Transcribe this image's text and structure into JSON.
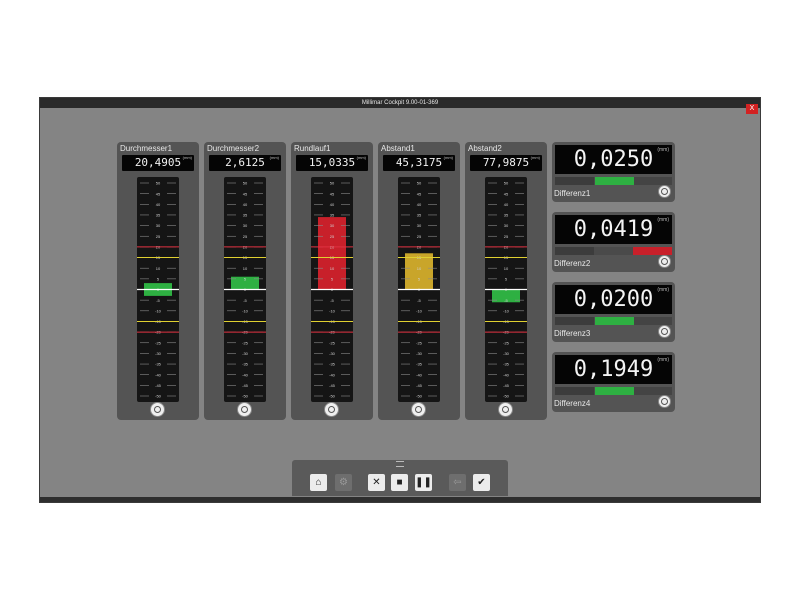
{
  "window": {
    "title": "Millimar Cockpit 9.00-01-369",
    "close_label": "X"
  },
  "unit": "(mm)",
  "scale_labels": [
    "50",
    "45",
    "40",
    "35",
    "30",
    "25",
    "20",
    "15",
    "10",
    "5",
    "0",
    "-5",
    "-10",
    "-15",
    "-20",
    "-25",
    "-30",
    "-35",
    "-40",
    "-45",
    "-50"
  ],
  "columns": [
    {
      "name": "Durchmesser1",
      "value": "20,4905",
      "bar": {
        "from": -3,
        "to": 3,
        "color": "#2eb042"
      }
    },
    {
      "name": "Durchmesser2",
      "value": "2,6125",
      "bar": {
        "from": 0,
        "to": 6,
        "color": "#2eb042"
      }
    },
    {
      "name": "Rundlauf1",
      "value": "15,0335",
      "bar": {
        "from": 0,
        "to": 34,
        "color": "#c8202a"
      }
    },
    {
      "name": "Abstand1",
      "value": "45,3175",
      "bar": {
        "from": 0,
        "to": 17,
        "color": "#c9a52a"
      }
    },
    {
      "name": "Abstand2",
      "value": "77,9875",
      "bar": {
        "from": -6,
        "to": 0,
        "color": "#2eb042"
      }
    }
  ],
  "differences": [
    {
      "label": "Differenz1",
      "value": "0,0250",
      "status": "ok",
      "indicator_color": "#2eb042"
    },
    {
      "label": "Differenz2",
      "value": "0,0419",
      "status": "error",
      "indicator_color": "#c8202a"
    },
    {
      "label": "Differenz3",
      "value": "0,0200",
      "status": "ok",
      "indicator_color": "#2eb042"
    },
    {
      "label": "Differenz4",
      "value": "0,1949",
      "status": "ok",
      "indicator_color": "#2eb042"
    }
  ],
  "toolbar": {
    "buttons": [
      {
        "icon": "home-icon",
        "glyph": "⌂",
        "enabled": true
      },
      {
        "icon": "settings-icon",
        "glyph": "⚙",
        "enabled": false
      },
      {
        "icon": "close-icon",
        "glyph": "✕",
        "enabled": true
      },
      {
        "icon": "stop-icon",
        "glyph": "■",
        "enabled": true
      },
      {
        "icon": "pause-icon",
        "glyph": "❚❚",
        "enabled": true
      },
      {
        "icon": "export-icon",
        "glyph": "⇦",
        "enabled": false
      },
      {
        "icon": "confirm-icon",
        "glyph": "✔",
        "enabled": true
      }
    ]
  },
  "colors": {
    "ok": "#2eb042",
    "error": "#c8202a",
    "warning": "#c9a52a",
    "upper_limit": "#e03040",
    "tolerance": "#e0d030"
  }
}
